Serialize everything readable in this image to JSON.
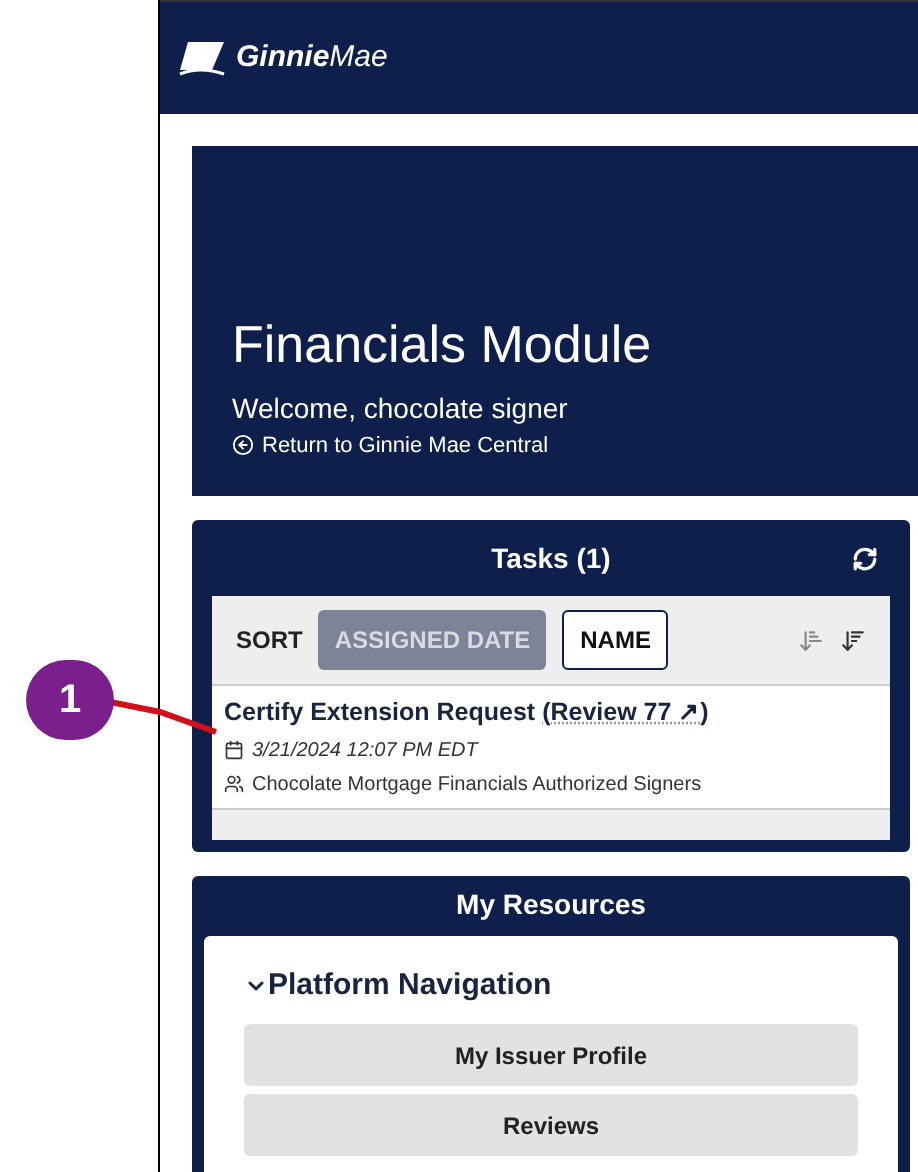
{
  "header": {
    "logo_bold": "Ginnie",
    "logo_light": "Mae"
  },
  "hero": {
    "title": "Financials Module",
    "welcome": "Welcome, chocolate signer",
    "return_link": "Return to Ginnie Mae Central"
  },
  "tasks": {
    "title": "Tasks (1)",
    "sort_label": "SORT",
    "sort_options": [
      {
        "label": "ASSIGNED DATE",
        "selected": true
      },
      {
        "label": "NAME",
        "selected": false
      }
    ],
    "items": [
      {
        "title": "Certify Extension Request",
        "link": "(Review 77 ↗)",
        "date": "3/21/2024 12:07 PM EDT",
        "group": "Chocolate Mortgage Financials Authorized Signers"
      }
    ]
  },
  "resources": {
    "title": "My Resources",
    "section": {
      "title": "Platform Navigation",
      "expanded": true,
      "links": [
        "My Issuer Profile",
        "Reviews"
      ]
    }
  },
  "callout": {
    "number": "1"
  }
}
